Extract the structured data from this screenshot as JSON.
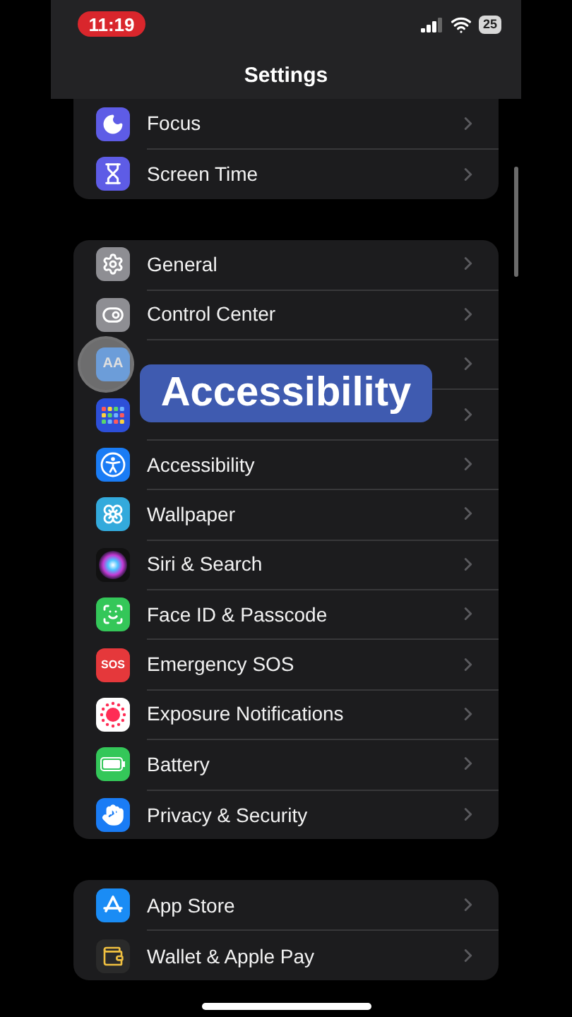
{
  "status_bar": {
    "time": "11:19",
    "battery": "25"
  },
  "title": "Settings",
  "groups": [
    {
      "rows": [
        {
          "kind": "focus",
          "label": "Focus"
        },
        {
          "kind": "screen_time",
          "label": "Screen Time"
        }
      ]
    },
    {
      "rows": [
        {
          "kind": "general",
          "label": "General"
        },
        {
          "kind": "control_center",
          "label": "Control Center"
        },
        {
          "kind": "display",
          "icon_text": "AA"
        },
        {
          "kind": "home_screen"
        },
        {
          "kind": "accessibility",
          "label": "Accessibility"
        },
        {
          "kind": "wallpaper",
          "label": "Wallpaper"
        },
        {
          "kind": "siri",
          "label": "Siri & Search"
        },
        {
          "kind": "face_id",
          "label": "Face ID & Passcode"
        },
        {
          "kind": "sos",
          "label": "Emergency SOS",
          "icon_text": "SOS"
        },
        {
          "kind": "exposure",
          "label": "Exposure Notifications"
        },
        {
          "kind": "battery",
          "label": "Battery"
        },
        {
          "kind": "privacy",
          "label": "Privacy & Security"
        }
      ]
    },
    {
      "rows": [
        {
          "kind": "app_store",
          "label": "App Store"
        },
        {
          "kind": "wallet",
          "label": "Wallet & Apple Pay"
        }
      ]
    }
  ],
  "caption": "Accessibility"
}
